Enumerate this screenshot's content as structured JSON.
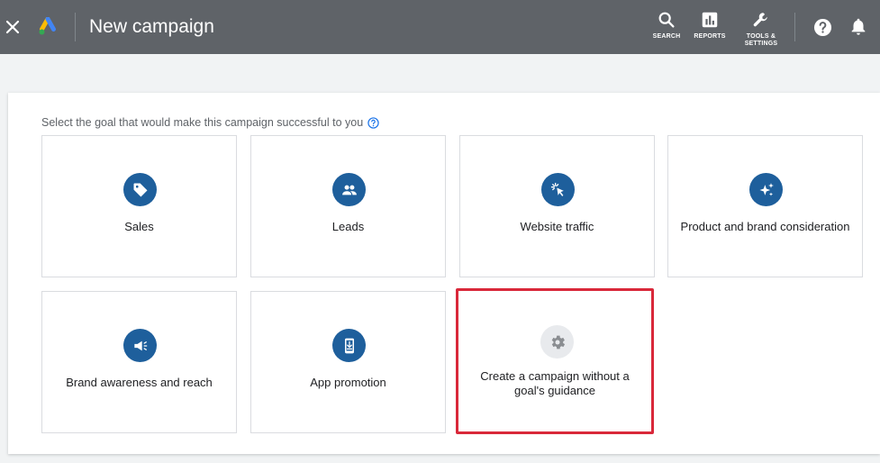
{
  "header": {
    "title": "New campaign",
    "actions": [
      {
        "label": "SEARCH",
        "icon": "search-icon"
      },
      {
        "label": "REPORTS",
        "icon": "reports-icon"
      },
      {
        "label": "TOOLS &\nSETTINGS",
        "icon": "wrench-icon"
      }
    ]
  },
  "main": {
    "instruction": "Select the goal that would make this campaign successful to you",
    "goals": [
      {
        "label": "Sales",
        "icon": "tag-icon"
      },
      {
        "label": "Leads",
        "icon": "people-icon"
      },
      {
        "label": "Website traffic",
        "icon": "cursor-click-icon"
      },
      {
        "label": "Product and brand consideration",
        "icon": "sparkle-icon"
      },
      {
        "label": "Brand awareness and reach",
        "icon": "megaphone-icon"
      },
      {
        "label": "App promotion",
        "icon": "phone-download-icon"
      },
      {
        "label": "Create a campaign without a goal's guidance",
        "icon": "gear-icon",
        "highlighted": true
      }
    ]
  },
  "colors": {
    "topbar": "#5f6368",
    "icon_circle": "#1e5f9c",
    "highlight_border": "#d9283a",
    "brand_blue": "#4285f4",
    "brand_yellow": "#fbbc04",
    "brand_green": "#34a853"
  }
}
